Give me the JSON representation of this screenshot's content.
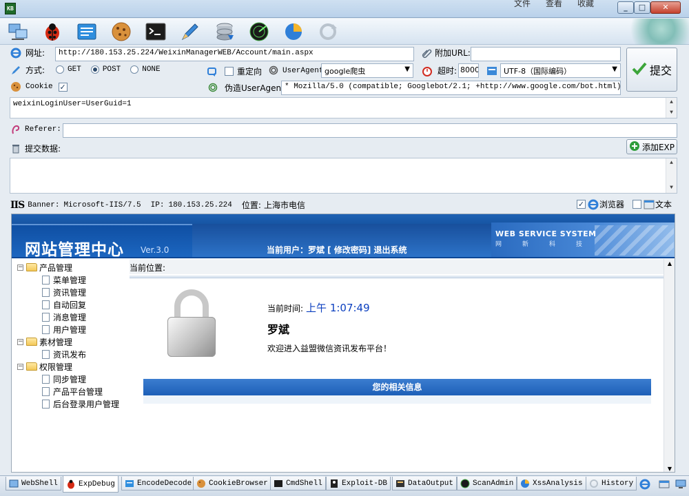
{
  "window": {
    "menu": [
      "文件",
      "查看",
      "收藏"
    ],
    "app_icon_text": "KB"
  },
  "toolbar": {
    "icons": [
      "network-icon",
      "bug-icon",
      "encode-icon",
      "cookie-icon",
      "terminal-icon",
      "pen-icon",
      "database-icon",
      "radar-icon",
      "chart-icon",
      "refresh-icon"
    ]
  },
  "request": {
    "url_label": "网址:",
    "url_value": "http://180.153.25.224/WeixinManagerWEB/Account/main.aspx",
    "extra_url_label": "附加URL:",
    "extra_url_value": "",
    "method_label": "方式:",
    "methods": [
      "GET",
      "POST",
      "NONE"
    ],
    "method_selected": "POST",
    "redirect_label": "重定向",
    "redirect_checked": false,
    "useragent_label": "UserAgent:",
    "useragent_value": "google爬虫",
    "timeout_label": "超时:",
    "timeout_value": "8000",
    "encoding_value": "UTF-8（国际编码）",
    "submit_label": "提交",
    "cookie_label": "Cookie",
    "cookie_checked": true,
    "fake_ua_label": "伪造UserAgent:",
    "fake_ua_value": "* Mozilla/5.0 (compatible; Googlebot/2.1; +http://www.google.com/bot.html)",
    "cookie_value": "weixinLoginUser=UserGuid=1",
    "referer_label": "Referer:",
    "referer_value": "",
    "postdata_label": "提交数据:",
    "add_exp_label": "添加EXP",
    "postdata_value": ""
  },
  "status": {
    "banner_label": "Banner:",
    "banner_value": "Microsoft-IIS/7.5",
    "ip_label": "IP:",
    "ip_value": "180.153.25.224",
    "location_label": "位置:",
    "location_value": "上海市电信",
    "browser_label": "浏览器",
    "browser_checked": true,
    "text_label": "文本",
    "text_checked": false
  },
  "site": {
    "logo_text": "网站管理中心",
    "logo_version": "Ver.3.0",
    "user_bar": "当前用户：罗斌 [ 修改密码]   退出系统",
    "wss_title": "WEB SERVICE SYSTEM",
    "wss_sub": "网新科技",
    "location": "当前位置:",
    "time_label": "当前时间:",
    "time_value": "上午 1:07:49",
    "user_name": "罗斌",
    "welcome": "欢迎进入益盟微信资讯发布平台！",
    "info_title": "您的相关信息",
    "tree": [
      {
        "label": "产品管理",
        "children": [
          "菜单管理",
          "资讯管理",
          "自动回复",
          "消息管理",
          "用户管理"
        ]
      },
      {
        "label": "素材管理",
        "children": [
          "资讯发布"
        ]
      },
      {
        "label": "权限管理",
        "children": [
          "同步管理",
          "产品平台管理",
          "后台登录用户管理"
        ]
      }
    ]
  },
  "tabs": [
    {
      "label": "WebShell",
      "icon": "webshell-icon",
      "active": false
    },
    {
      "label": "ExpDebug",
      "icon": "bug-icon",
      "active": true
    },
    {
      "label": "EncodeDecode",
      "icon": "encode-icon",
      "active": false
    },
    {
      "label": "CookieBrowser",
      "icon": "cookie-icon",
      "active": false
    },
    {
      "label": "CmdShell",
      "icon": "terminal-icon",
      "active": false
    },
    {
      "label": "Exploit-DB",
      "icon": "exploit-icon",
      "active": false
    },
    {
      "label": "DataOutput",
      "icon": "data-icon",
      "active": false
    },
    {
      "label": "ScanAdmin",
      "icon": "scan-icon",
      "active": false
    },
    {
      "label": "XssAnalysis",
      "icon": "xss-icon",
      "active": false
    },
    {
      "label": "History",
      "icon": "history-icon",
      "active": false
    }
  ]
}
